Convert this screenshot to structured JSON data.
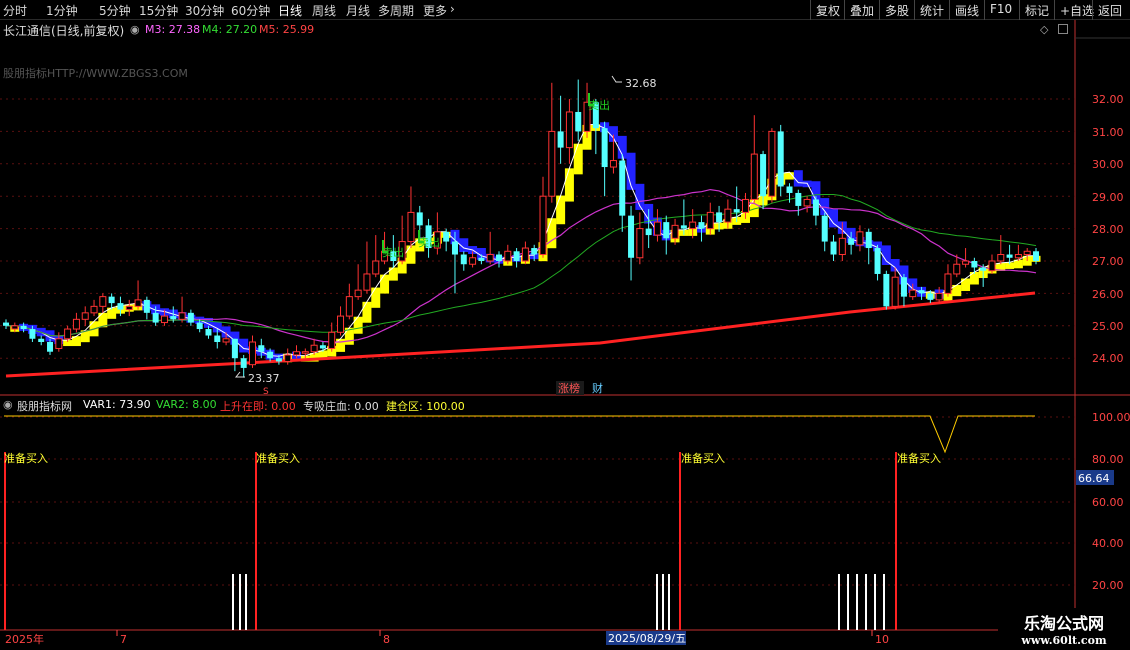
{
  "toolbar": {
    "periods": [
      "分时",
      "1分钟",
      "5分钟",
      "15分钟",
      "30分钟",
      "60分钟",
      "日线",
      "周线",
      "月线",
      "多周期",
      "更多"
    ],
    "active_period": "日线",
    "right_buttons": [
      "复权",
      "叠加",
      "多股",
      "统计",
      "画线",
      "F10",
      "标记",
      "+自选",
      "返回"
    ]
  },
  "stock": {
    "title": "长江通信(日线,前复权)",
    "ma3": "M3: 27.38",
    "ma4": "M4: 27.20",
    "ma5": "M5: 25.99",
    "ma3_color": "#ff66ff",
    "ma4_color": "#33dd33",
    "ma5_color": "#ff3333"
  },
  "watermark": "股朋指标HTTP://WWW.ZBGS3.COM",
  "annotations": {
    "high_label": "32.68",
    "low_label": "23.37",
    "sell_label": "卖出",
    "zhangbang": "涨榜",
    "cai": "财",
    "s_mark": "S"
  },
  "price_axis": [
    "32.00",
    "31.00",
    "30.00",
    "29.00",
    "28.00",
    "27.00",
    "26.00",
    "25.00",
    "24.00"
  ],
  "indicator": {
    "name": "股朋指标网",
    "var1": "VAR1: 73.90",
    "var2": "VAR2: 8.00",
    "up": "上升在即: 0.00",
    "absorb": "专吸庄血: 0.00",
    "build": "建仓区: 100.00",
    "buy_label": "准备买入",
    "axis": [
      "100.00",
      "80.00",
      "60.00",
      "40.00",
      "20.00"
    ],
    "current_value": "66.64"
  },
  "date_axis": {
    "labels": [
      "2025年",
      "7",
      "8",
      "2025/08/29/五",
      "10"
    ]
  },
  "brand": {
    "name": "乐淘公式网",
    "url": "www.60lt.com"
  },
  "colors": {
    "up": "#ff3333",
    "down": "#55ffff",
    "ribbon": "#ffff00",
    "ribbon_down": "#2222ff",
    "ma_pink": "#cc33cc",
    "ma_green": "#22aa22",
    "ma_red": "#ff2222"
  }
}
